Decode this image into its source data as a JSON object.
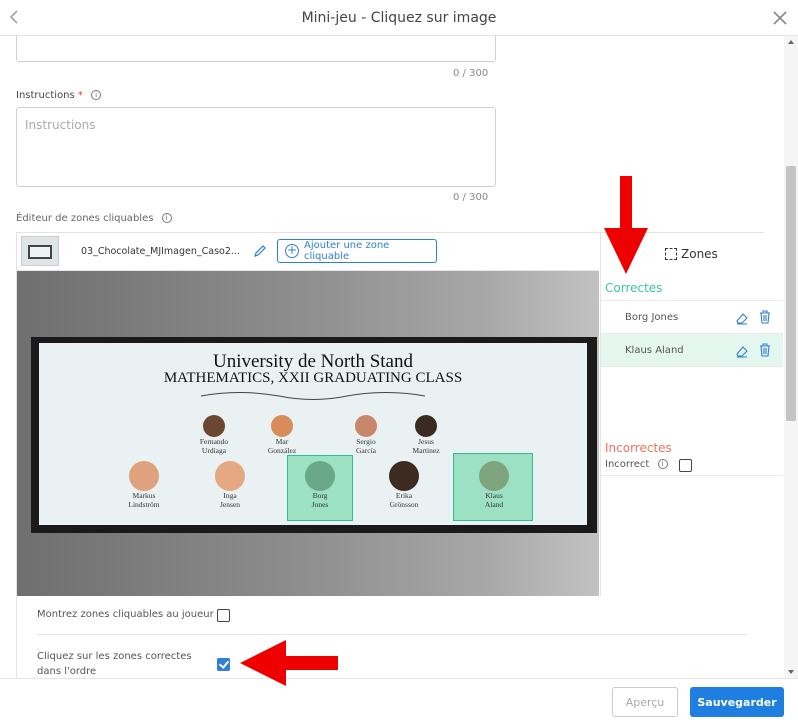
{
  "header": {
    "title": "Mini-jeu - Cliquez sur image"
  },
  "form": {
    "top_counter": "0 / 300",
    "instructions_label": "Instructions",
    "instructions_required": "*",
    "instructions_placeholder": "Instructions",
    "instructions_counter": "0 / 300",
    "editor_label": "Éditeur de zones cliquables"
  },
  "toolbar": {
    "filename": "03_Chocolate_MJImagen_Caso2...",
    "add_zone_label": "Ajouter une zone cliquable"
  },
  "board": {
    "title_line1": "University de North Stand",
    "title_line2": "MATHEMATICS, XXII GRADUATING CLASS",
    "people_row1": [
      {
        "name": "Fernando\nUrdiaga"
      },
      {
        "name": "Mar\nGonzález"
      },
      {
        "name": "Sergio\nGarcía"
      },
      {
        "name": "Jesus\nMartinez"
      }
    ],
    "people_row2": [
      {
        "name": "Markus\nLindström"
      },
      {
        "name": "Inga\nJensen"
      },
      {
        "name": "Borg\nJones"
      },
      {
        "name": "Erika\nGrönsson"
      },
      {
        "name": "Klaus\nAland"
      }
    ]
  },
  "zones_panel": {
    "title": "Zones",
    "correct_label": "Correctes",
    "correct_items": [
      {
        "label": "Borg Jones",
        "selected": false
      },
      {
        "label": "Klaus Aland",
        "selected": true
      }
    ],
    "incorrect_label": "Incorrectes",
    "incorrect_field_label": "Incorrect",
    "incorrect_checked": false
  },
  "options": {
    "show_zones_label": "Montrez zones cliquables au joueur",
    "show_zones_checked": false,
    "order_label": "Cliquez sur les zones correctes dans l'ordre",
    "order_checked": true
  },
  "footer": {
    "preview_label": "Aperçu",
    "save_label": "Sauvegarder"
  },
  "colors": {
    "primary": "#1f7fe0",
    "correct": "#3cc79a",
    "incorrect": "#f07060",
    "annotation_arrow": "#ee0000"
  }
}
